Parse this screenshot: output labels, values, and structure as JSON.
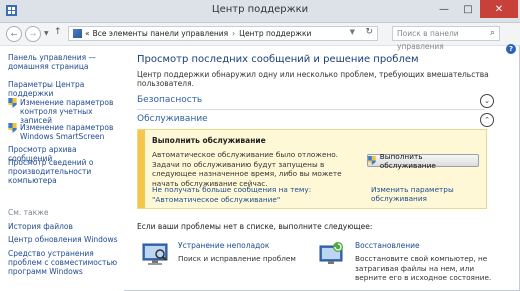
{
  "window": {
    "title": "Центр поддержки",
    "controls": {
      "minimize": "—",
      "maximize": "□",
      "close": "✕"
    }
  },
  "address": {
    "back": "←",
    "forward": "→",
    "up": "↑",
    "breadcrumb": [
      "Все элементы панели управления",
      "Центр поддержки"
    ],
    "breadcrumb_sep": "›",
    "search_placeholder": "Поиск в панели управления",
    "search_icon": "search-icon"
  },
  "help_label": "?",
  "sidebar": {
    "home_label": "Панель управления — домашняя страница",
    "items": [
      {
        "label": "Параметры Центра поддержки",
        "icon": null
      },
      {
        "label": "Изменение параметров контроля учетных записей",
        "icon": "uac-shield-icon"
      },
      {
        "label": "Изменение параметров Windows SmartScreen",
        "icon": "uac-shield-icon"
      },
      {
        "label": "Просмотр архива сообщений",
        "icon": null
      },
      {
        "label": "Просмотр сведений о производительности компьютера",
        "icon": null
      }
    ],
    "see_also_title": "См. также",
    "see_also": [
      "История файлов",
      "Центр обновления Windows",
      "Средство устранения проблем с совместимостью программ Windows"
    ]
  },
  "main": {
    "title": "Просмотр последних сообщений и решение проблем",
    "subtitle": "Центр поддержки обнаружил одну или несколько проблем, требующих вмешательства пользователя.",
    "sections": [
      {
        "label": "Безопасность",
        "expanded": false
      },
      {
        "label": "Обслуживание",
        "expanded": true
      }
    ],
    "alert": {
      "title": "Выполнить обслуживание",
      "body": "Автоматическое обслуживание было отложено. Задачи по обслуживанию будут запущены в следующее назначенное время, либо вы можете начать обслуживание сейчас.",
      "button": "Выполнить обслуживание",
      "link_dismiss": "Не получать больше сообщения на тему: \"Автоматическое обслуживание\"",
      "link_settings": "Изменить параметры обслуживания",
      "stripe_color": "#f4c64a"
    },
    "note": "Если ваши проблемы нет в списке, выполните следующее:",
    "tiles": [
      {
        "title": "Устранение неполадок",
        "desc": "Поиск и исправление проблем",
        "icon": "troubleshoot-icon"
      },
      {
        "title": "Восстановление",
        "desc": "Восстановите свой компьютер, не затрагивая файлы на нем, или верните его в исходное состояние.",
        "icon": "recovery-icon"
      }
    ]
  }
}
